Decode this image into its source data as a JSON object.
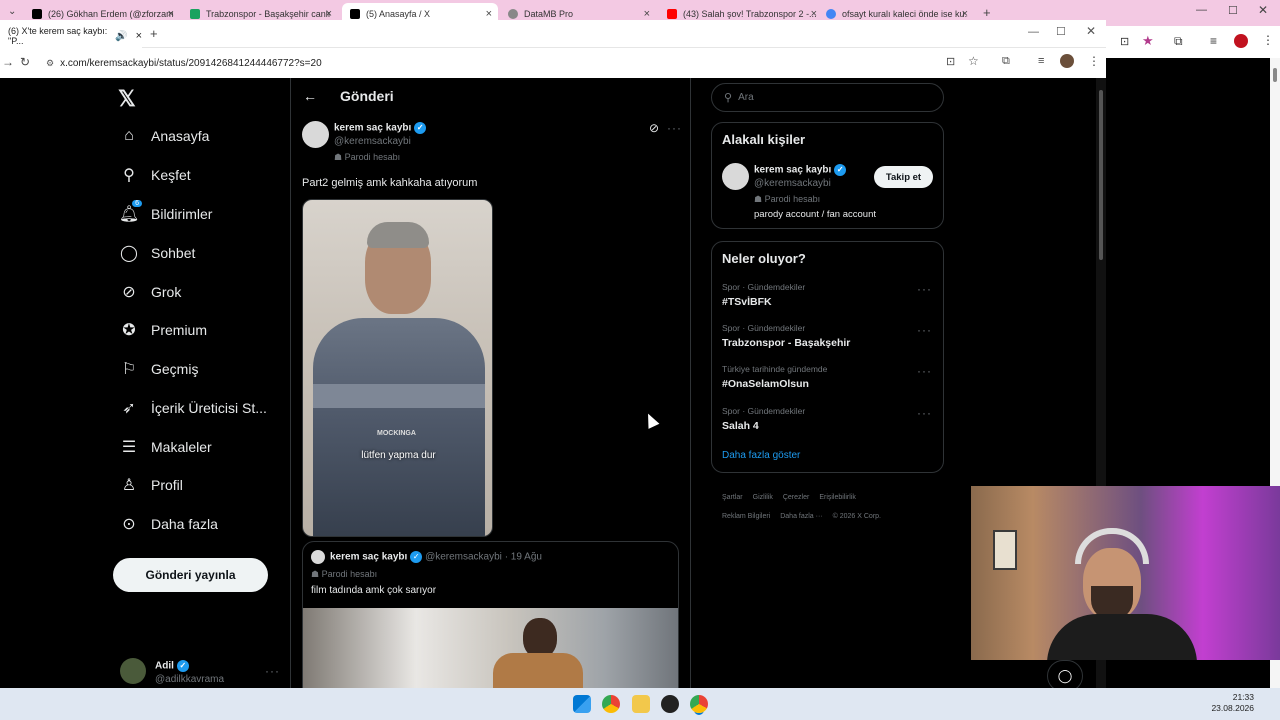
{
  "back_tabs": [
    {
      "label": "(26) Gökhan Erdem (@zforzam...",
      "icon": "x-icon"
    },
    {
      "label": "Trabzonspor - Başakşehir canlı ...",
      "icon": "sheet-icon"
    },
    {
      "label": "(5) Anasayfa / X",
      "icon": "x-icon"
    },
    {
      "label": "DataMB Pro",
      "icon": "globe-icon"
    },
    {
      "label": "(43) Salah şov! Trabzonspor 2 -...",
      "icon": "youtube-icon"
    },
    {
      "label": "ofsayt kuralı kaleci önde ise ku...",
      "icon": "google-icon"
    }
  ],
  "front_tab": {
    "label": "(6) X'te kerem saç kaybı: \"P..."
  },
  "url": "x.com/keremsackaybi/status/2091426841244446772?s=20",
  "nav": {
    "items": [
      {
        "label": "Anasayfa",
        "icon": "home-icon"
      },
      {
        "label": "Keşfet",
        "icon": "search-icon"
      },
      {
        "label": "Bildirimler",
        "icon": "bell-icon",
        "badge": "6"
      },
      {
        "label": "Sohbet",
        "icon": "chat-icon"
      },
      {
        "label": "Grok",
        "icon": "grok-icon"
      },
      {
        "label": "Premium",
        "icon": "premium-icon"
      },
      {
        "label": "Geçmiş",
        "icon": "bookmark-icon"
      },
      {
        "label": "İçerik Üreticisi St...",
        "icon": "rocket-icon"
      },
      {
        "label": "Makaleler",
        "icon": "article-icon"
      },
      {
        "label": "Profil",
        "icon": "person-icon"
      },
      {
        "label": "Daha fazla",
        "icon": "more-icon"
      }
    ],
    "post_button": "Gönderi yayınla"
  },
  "account": {
    "name": "Adil",
    "handle": "@adilkkavrama"
  },
  "header": {
    "title": "Gönderi"
  },
  "post": {
    "author": "kerem saç kaybı",
    "handle": "@keremsackaybi",
    "parody": "Parodi hesabı",
    "text": "Part2 gelmiş amk kahkaha atıyorum",
    "video_caption": "lütfen yapma dur",
    "video_overlay": "MOCKINGA"
  },
  "quote": {
    "author": "kerem saç kaybı",
    "handle": "@keremsackaybi",
    "date": "· 19 Ağu",
    "parody": "Parodi hesabı",
    "text": "film tadında amk çok sarıyor"
  },
  "search": {
    "placeholder": "Ara"
  },
  "related": {
    "title": "Alakalı kişiler",
    "name": "kerem saç kaybı",
    "handle": "@keremsackaybi",
    "parody": "Parodi hesabı",
    "bio": "parody account / fan account",
    "follow": "Takip et"
  },
  "trends": {
    "title": "Neler oluyor?",
    "items": [
      {
        "cat": "Spor · Gündemdekiler",
        "name": "#TSvİBFK"
      },
      {
        "cat": "Spor · Gündemdekiler",
        "name": "Trabzonspor - Başakşehir"
      },
      {
        "cat": "Türkiye tarihinde gündemde",
        "name": "#OnaSelamOlsun"
      },
      {
        "cat": "Spor · Gündemdekiler",
        "name": "Salah 4"
      }
    ],
    "more": "Daha fazla göster"
  },
  "footer": {
    "links": [
      "Şartlar",
      "Gizlilik",
      "Çerezler",
      "Erişilebilirlik",
      "Reklam Bilgileri",
      "Daha fazla ···",
      "© 2026 X Corp."
    ]
  },
  "clock": {
    "time": "21:33",
    "date": "23.08.2026"
  },
  "colors": {
    "accent": "#1d9bf0",
    "tabbar": "#f3c9e3",
    "bg": "#000000"
  }
}
